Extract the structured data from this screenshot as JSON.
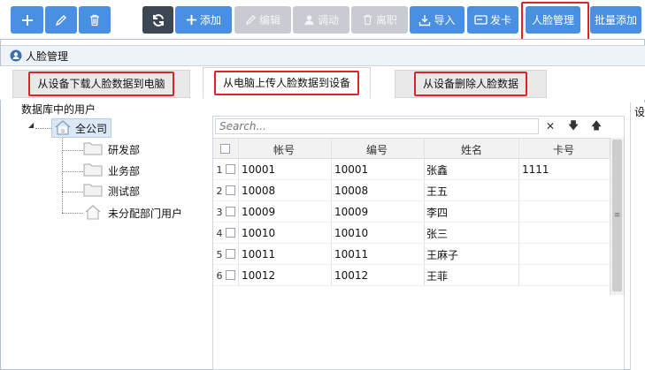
{
  "toolbar": {
    "refresh_icon": "refresh-icon",
    "add_label": "添加",
    "edit_label": "编辑",
    "transfer_label": "调动",
    "resign_label": "离职",
    "import_label": "导入",
    "issue_card_label": "发卡",
    "face_manage_label": "人脸管理",
    "batch_add_label": "批量添加"
  },
  "window": {
    "title": "人脸管理"
  },
  "tabs": [
    {
      "label": "从设备下载人脸数据到电脑"
    },
    {
      "label": "从电脑上传人脸数据到设备"
    },
    {
      "label": "从设备删除人脸数据"
    }
  ],
  "left_panel": {
    "label": "数据库中的用户",
    "tree": {
      "root": "全公司",
      "children": [
        "研发部",
        "业务部",
        "测试部",
        "未分配部门用户"
      ]
    }
  },
  "right_panel": {
    "label_partial": "设"
  },
  "grid": {
    "search_placeholder": "Search...",
    "columns": [
      "帐号",
      "编号",
      "姓名",
      "卡号"
    ],
    "rows": [
      {
        "num": "1",
        "account": "10001",
        "id": "10001",
        "name": "张鑫",
        "card": "1111"
      },
      {
        "num": "2",
        "account": "10008",
        "id": "10008",
        "name": "王五",
        "card": ""
      },
      {
        "num": "3",
        "account": "10009",
        "id": "10009",
        "name": "李四",
        "card": ""
      },
      {
        "num": "4",
        "account": "10010",
        "id": "10010",
        "name": "张三",
        "card": ""
      },
      {
        "num": "5",
        "account": "10011",
        "id": "10011",
        "name": "王麻子",
        "card": ""
      },
      {
        "num": "6",
        "account": "10012",
        "id": "10012",
        "name": "王菲",
        "card": ""
      }
    ]
  },
  "colors": {
    "primary": "#4a90e2",
    "dark": "#3c4654",
    "disabled": "#c8ccd2",
    "highlight": "#d9262c"
  }
}
